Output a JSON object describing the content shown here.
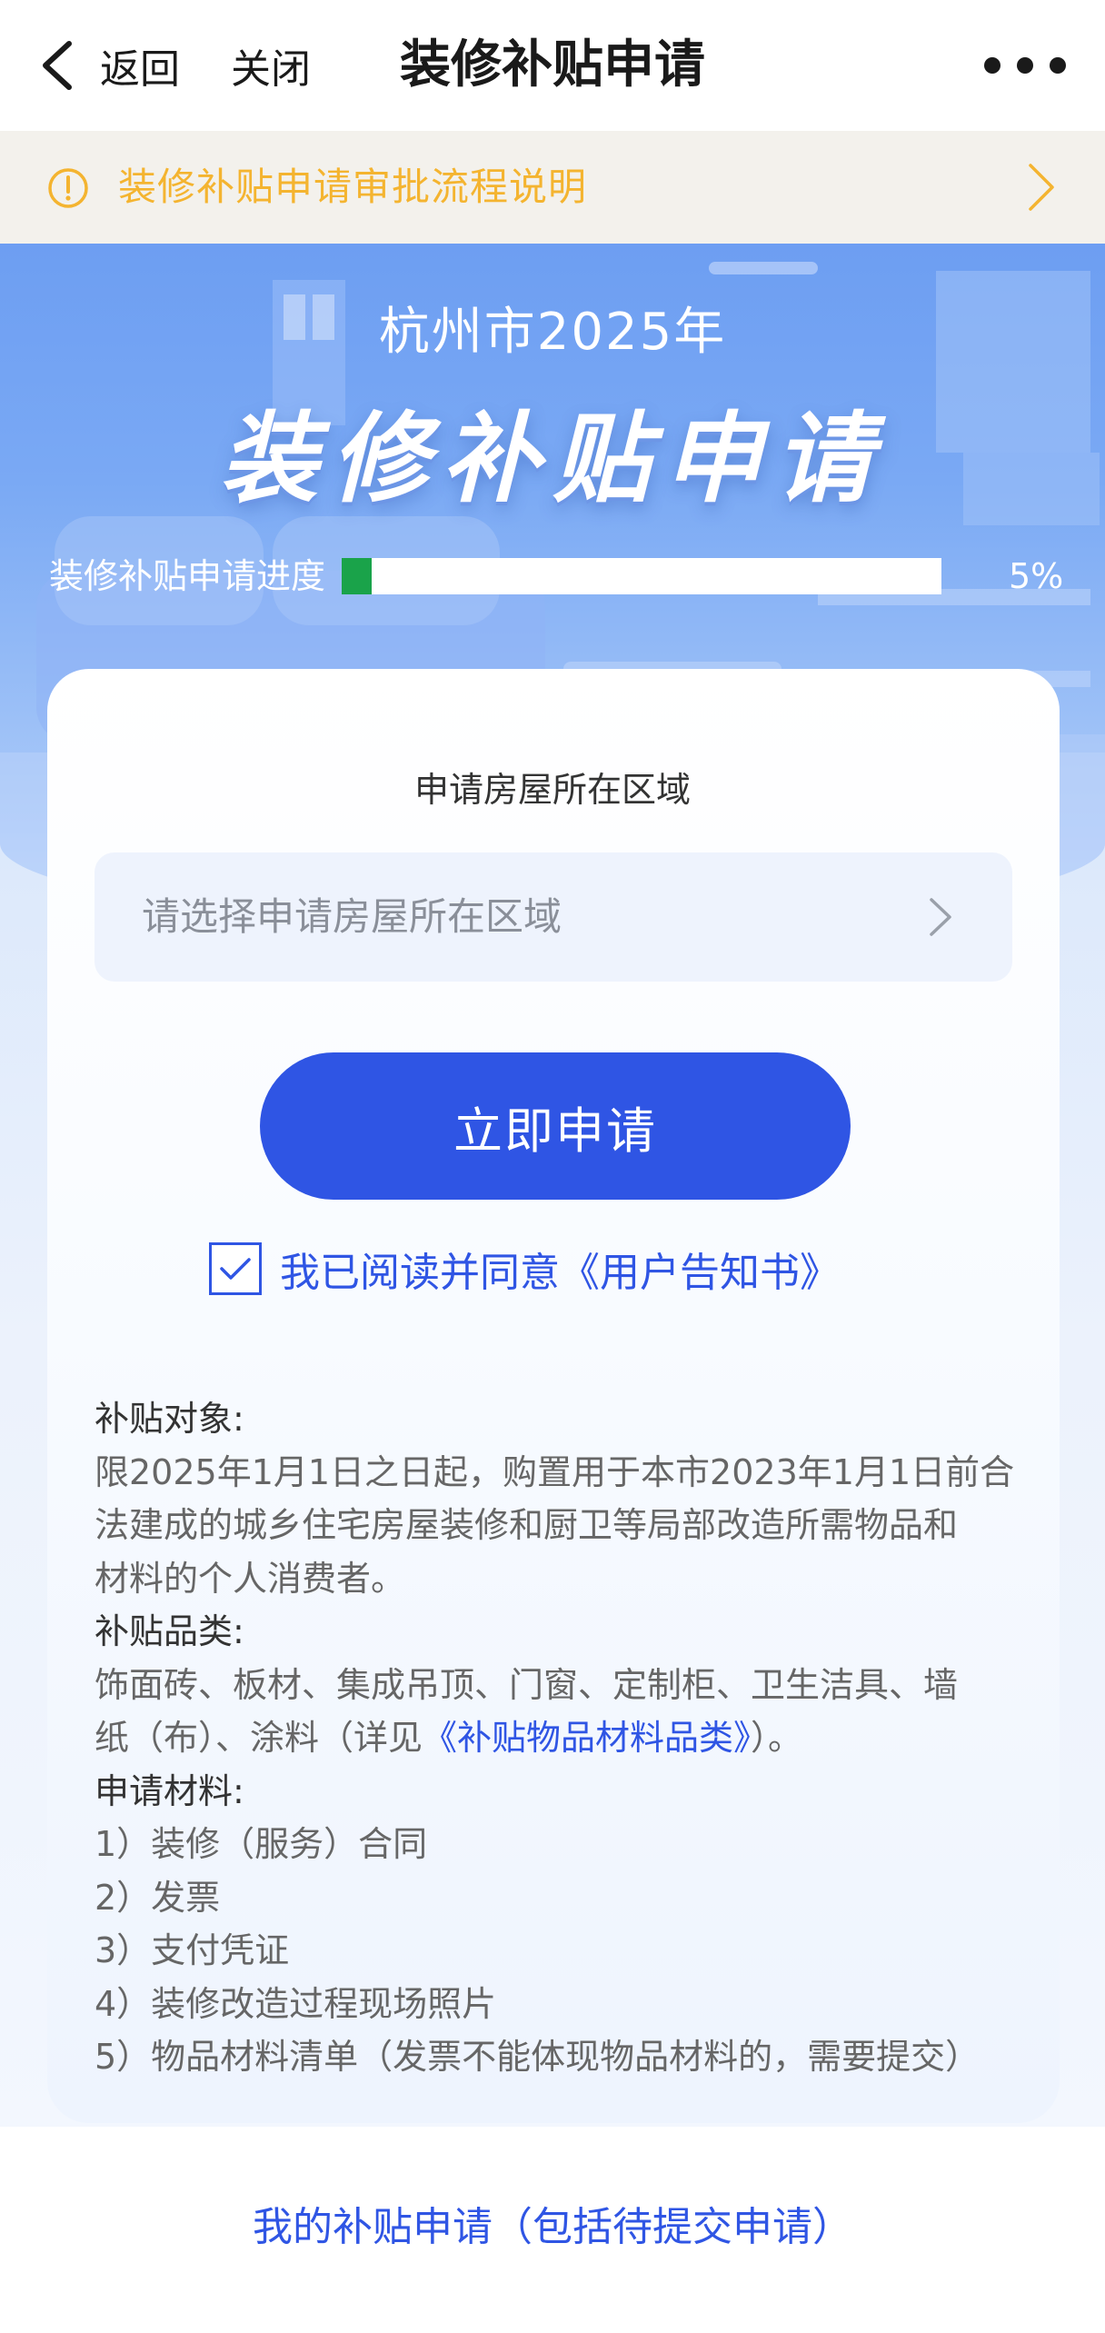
{
  "nav": {
    "back_label": "返回",
    "close_label": "关闭",
    "title": "装修补贴申请"
  },
  "notice": {
    "text": "装修补贴申请审批流程说明"
  },
  "hero": {
    "subtitle": "杭州市2025年",
    "title": "装修补贴申请",
    "progress_label": "装修补贴申请进度",
    "progress_value": "5%",
    "progress_fraction": 0.05
  },
  "form": {
    "region_label": "申请房屋所在区域",
    "region_placeholder": "请选择申请房屋所在区域",
    "apply_label": "立即申请",
    "agree_text": "我已阅读并同意《用户告知书》",
    "agree_checked": true
  },
  "info": {
    "target_head": "补贴对象:",
    "target_lines": [
      "限2025年1月1日之日起，购置用于本市2023年1月1日前合",
      "法建成的城乡住宅房屋装修和厨卫等局部改造所需物品和",
      "材料的个人消费者。"
    ],
    "category_head": "补贴品类:",
    "category_line1": "饰面砖、板材、集成吊顶、门窗、定制柜、卫生洁具、墙",
    "category_line2_prefix": "纸（布）、涂料（详见",
    "category_link": "《补贴物品材料品类》",
    "category_line2_suffix": "）。",
    "materials_head": "申请材料:",
    "materials": [
      "1）装修（服务）合同",
      "2）发票",
      "3）支付凭证",
      "4）装修改造过程现场照片",
      "5）物品材料清单（发票不能体现物品材料的，需要提交）"
    ]
  },
  "footer": {
    "link": "我的补贴申请（包括待提交申请）"
  },
  "colors": {
    "accent": "#2f55e4",
    "notice_text": "#f4b430",
    "notice_bg": "#f3f1ec",
    "progress_fill": "#1aa34a"
  },
  "icons": {
    "back": "chevron-left-icon",
    "more": "more-dots-icon",
    "notice": "exclamation-circle-icon",
    "notice_arrow": "chevron-right-icon",
    "region_arrow": "chevron-right-icon",
    "check": "check-icon"
  }
}
